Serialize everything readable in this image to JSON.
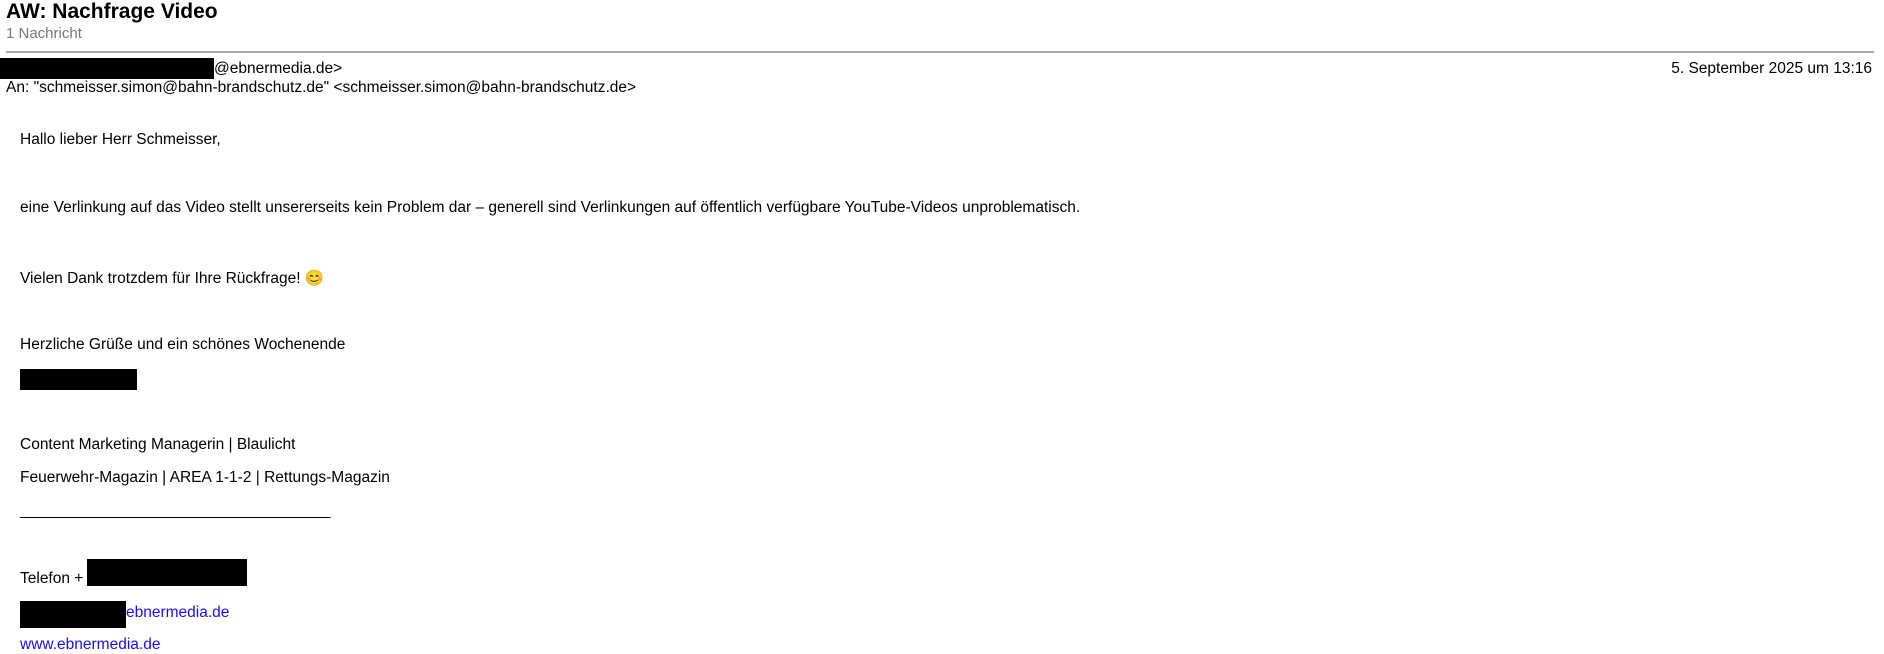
{
  "subject": "AW: Nachfrage Video",
  "message_count": "1 Nachricht",
  "from_suffix": "@ebnermedia.de>",
  "to": "An: \"schmeisser.simon@bahn-brandschutz.de\" <schmeisser.simon@bahn-brandschutz.de>",
  "date": "5. September 2025 um 13:16",
  "body": {
    "greeting": "Hallo lieber Herr Schmeisser,",
    "para1": "eine Verlinkung auf das Video stellt unsererseits kein Problem dar – generell sind Verlinkungen auf öffentlich verfügbare YouTube-Videos unproblematisch.",
    "para2": "Vielen Dank trotzdem für Ihre Rückfrage! 😊",
    "closing": "Herzliche Grüße und ein schönes Wochenende",
    "role": "Content Marketing Managerin | Blaulicht",
    "brands": "Feuerwehr-Magazin | AREA 1-1-2 | Rettungs-Magazin",
    "separator": "____________________________________",
    "phone_prefix": "Telefon +",
    "email_suffix": "ebnermedia.de",
    "website": "www.ebnermedia.de"
  }
}
